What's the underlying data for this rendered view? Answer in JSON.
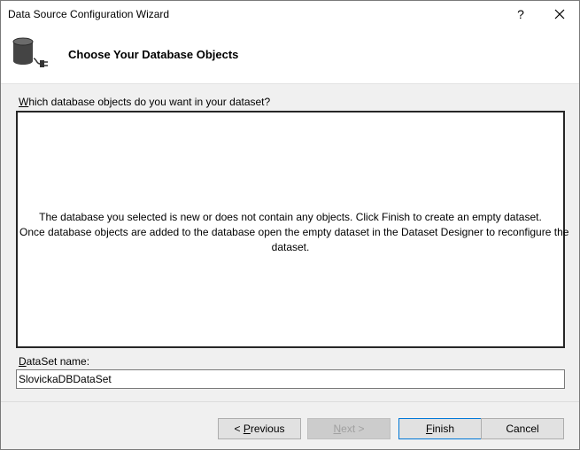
{
  "window": {
    "title": "Data Source Configuration Wizard",
    "help_glyph": "?"
  },
  "header": {
    "title": "Choose Your Database Objects",
    "icon": "database-connection-icon"
  },
  "objects": {
    "question_mnemonic": "W",
    "question_rest": "hich database objects do you want in your dataset?",
    "message_line1": "The database you selected is new or does not contain any objects. Click Finish to create an empty dataset.",
    "message_line2": "Once database objects are added to the database open the empty dataset in the Dataset Designer to reconfigure the",
    "message_line3": "dataset."
  },
  "dataset": {
    "label_mnemonic": "D",
    "label_rest": "ataSet name:",
    "value": "SlovickaDBDataSet"
  },
  "buttons": {
    "previous_prefix": "< ",
    "previous_mnemonic": "P",
    "previous_rest": "revious",
    "next_mnemonic": "N",
    "next_rest": "ext >",
    "finish_mnemonic": "F",
    "finish_rest": "inish",
    "cancel_label": "Cancel"
  },
  "colors": {
    "accent_border": "#0078d7",
    "disabled_text": "#a0a0a0"
  }
}
